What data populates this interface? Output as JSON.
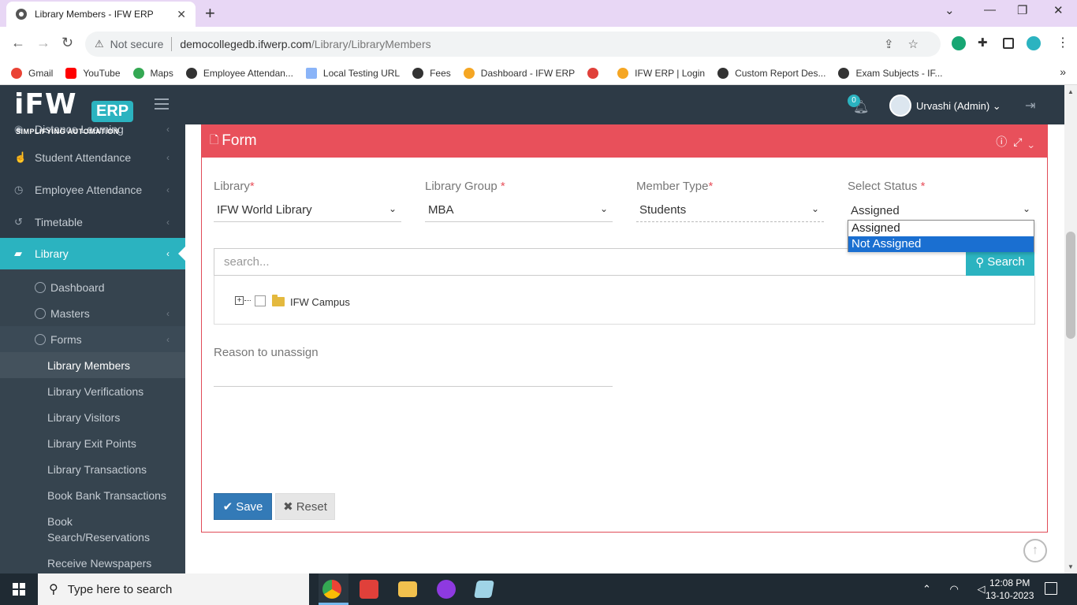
{
  "browser": {
    "tab_title": "Library Members - IFW ERP",
    "not_secure": "Not secure",
    "url_host": "democollegedb.ifwerp.com",
    "url_path": "/Library/LibraryMembers",
    "bookmarks": [
      {
        "label": "Gmail",
        "icon": "gmail-icon",
        "color": "#ea4335"
      },
      {
        "label": "YouTube",
        "icon": "youtube-icon",
        "color": "#ff0000"
      },
      {
        "label": "Maps",
        "icon": "maps-icon",
        "color": "#34a853"
      },
      {
        "label": "Employee Attendan...",
        "icon": "globe-icon",
        "color": "#333333"
      },
      {
        "label": "Local Testing URL",
        "icon": "page-icon",
        "color": "#8ab4f8"
      },
      {
        "label": "Fees",
        "icon": "globe-icon",
        "color": "#333333"
      },
      {
        "label": "Dashboard - IFW ERP",
        "icon": "ifw-icon",
        "color": "#f5a623"
      },
      {
        "label": "",
        "icon": "red-circle-icon",
        "color": "#e0403a"
      },
      {
        "label": "IFW ERP | Login",
        "icon": "ifw-icon",
        "color": "#f5a623"
      },
      {
        "label": "Custom Report Des...",
        "icon": "globe-icon",
        "color": "#333333"
      },
      {
        "label": "Exam Subjects - IF...",
        "icon": "globe-icon",
        "color": "#333333"
      }
    ]
  },
  "header": {
    "logo_main": "iFW",
    "logo_erp": "ERP",
    "logo_tagline": "SIMPLIFYING AUTOMATION",
    "notification_count": "0",
    "user_name": "Urvashi (Admin)"
  },
  "sidebar": {
    "items": [
      {
        "label": "Distance Learning"
      },
      {
        "label": "Student Attendance"
      },
      {
        "label": "Employee Attendance"
      },
      {
        "label": "Timetable"
      },
      {
        "label": "Library"
      }
    ],
    "library_sub": [
      {
        "label": "Dashboard"
      },
      {
        "label": "Masters"
      },
      {
        "label": "Forms"
      }
    ],
    "forms_sub": [
      {
        "label": "Library Members"
      },
      {
        "label": "Library Verifications"
      },
      {
        "label": "Library Visitors"
      },
      {
        "label": "Library Exit Points"
      },
      {
        "label": "Library Transactions"
      },
      {
        "label": "Book Bank Transactions"
      },
      {
        "label": "Book Search/Reservations"
      },
      {
        "label": "Receive Newspapers"
      }
    ]
  },
  "form": {
    "title": "Form",
    "fields": [
      {
        "label": "Library",
        "value": "IFW World Library"
      },
      {
        "label": "Library Group ",
        "value": "MBA"
      },
      {
        "label": "Member Type",
        "value": "Students"
      },
      {
        "label": "Select Status ",
        "value": "Assigned"
      }
    ],
    "status_options": [
      "Assigned",
      "Not Assigned"
    ],
    "search_placeholder": "search...",
    "search_button": "Search",
    "tree_node": "IFW Campus",
    "reason_label": "Reason to unassign",
    "save_label": "Save",
    "reset_label": "Reset"
  },
  "taskbar": {
    "search_placeholder": "Type here to search",
    "time": "12:08 PM",
    "date": "13-10-2023"
  },
  "colors": {
    "accent": "#2bb3c0",
    "form_header": "#e8505b",
    "sidebar_bg": "#2d3a46",
    "save_button": "#337ab7"
  }
}
